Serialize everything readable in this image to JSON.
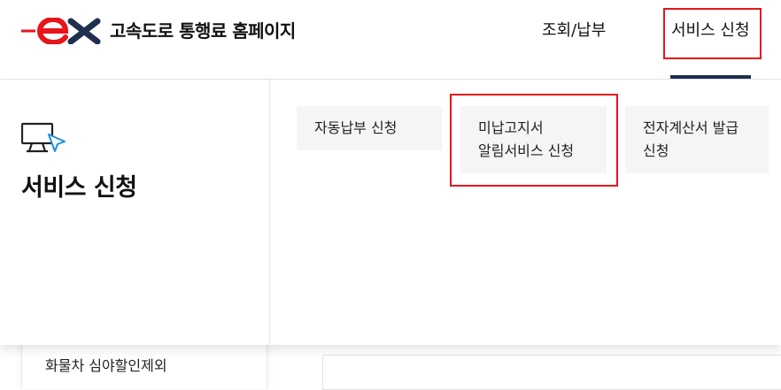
{
  "header": {
    "logo_text": "ex",
    "site_title": "고속도로 통행료 홈페이지",
    "nav": [
      {
        "label": "조회/납부"
      },
      {
        "label": "서비스 신청"
      }
    ]
  },
  "mega_menu": {
    "section_title": "서비스 신청",
    "icon": "monitor-cursor-icon",
    "items": [
      {
        "line1": "자동납부 신청",
        "line2": ""
      },
      {
        "line1": "미납고지서",
        "line2": "알림서비스 신청"
      },
      {
        "line1": "전자계산서 발급",
        "line2": "신청"
      }
    ]
  },
  "page": {
    "sidebar_item": "화물차 심야할인제외"
  },
  "colors": {
    "brand_red": "#e8141b",
    "brand_navy": "#1e2f4f",
    "highlight": "#e8141b"
  }
}
